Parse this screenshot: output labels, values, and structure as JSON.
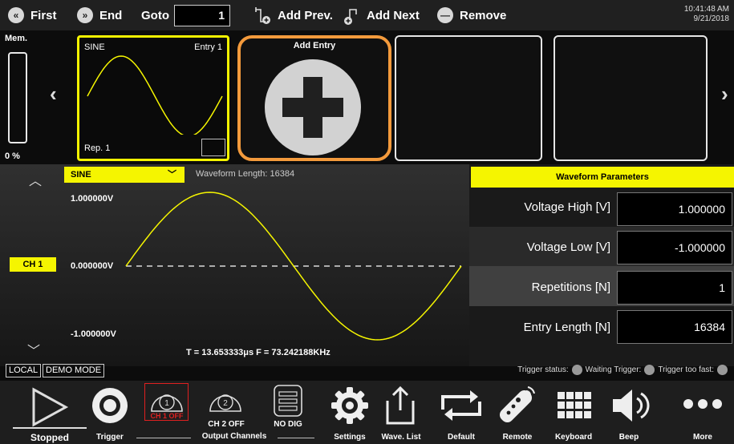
{
  "toolbar": {
    "first_label": "First",
    "end_label": "End",
    "goto_label": "Goto",
    "goto_value": "1",
    "add_prev_label": "Add Prev.",
    "add_next_label": "Add Next",
    "remove_label": "Remove",
    "time": "10:41:48 AM",
    "date": "9/21/2018"
  },
  "memory": {
    "label": "Mem.",
    "percent_text": "0 %",
    "percent_value": 0
  },
  "entries": [
    {
      "name": "SINE",
      "entry_label": "Entry  1",
      "rep_label": "Rep.  1"
    },
    {
      "add_label": "Add Entry"
    }
  ],
  "waveform": {
    "selected": "SINE",
    "length_text": "Waveform Length: 16384",
    "channel": "CH 1",
    "v_high": "1.000000V",
    "v_mid": "0.000000V",
    "v_low": "-1.000000V",
    "period_freq": "T =  13.653333μs  F =  73.242188KHz"
  },
  "parameters": {
    "title": "Waveform Parameters",
    "rows": [
      {
        "label": "Voltage High [V]",
        "value": "1.000000"
      },
      {
        "label": "Voltage Low [V]",
        "value": "-1.000000"
      },
      {
        "label": "Repetitions [N]",
        "value": "1"
      },
      {
        "label": "Entry Length [N]",
        "value": "16384"
      }
    ]
  },
  "status": {
    "local": "LOCAL",
    "demo": "DEMO MODE",
    "trigger_status": "Trigger status:",
    "waiting": "Waiting Trigger:",
    "too_fast": "Trigger too fast:"
  },
  "bottom": {
    "stopped": "Stopped",
    "trigger": "Trigger",
    "ch1": "CH 1 OFF",
    "ch2": "CH 2 OFF",
    "nodig": "NO DIG",
    "output_channels": "Output Channels",
    "settings": "Settings",
    "wave_list": "Wave. List",
    "default": "Default",
    "remote": "Remote",
    "keyboard": "Keyboard",
    "beep": "Beep",
    "more": "More"
  },
  "colors": {
    "accent": "#f5f500",
    "selection": "#f39a3c",
    "alert": "#e02020"
  }
}
